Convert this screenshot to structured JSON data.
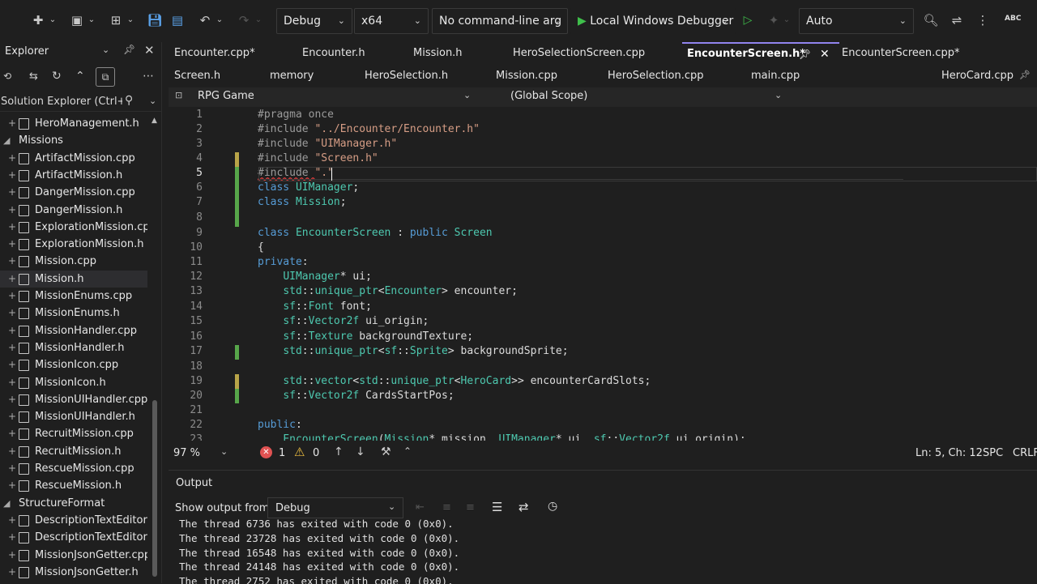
{
  "toolbar": {
    "config": "Debug",
    "platform": "x64",
    "args": "No command-line arg",
    "debugger": "Local Windows Debugger",
    "target": "Auto",
    "spell_label": "ABC"
  },
  "solution_explorer": {
    "title": "Explorer",
    "search_placeholder": "Solution Explorer (Ctrl+ş",
    "items": [
      {
        "label": "HeroManagement.h",
        "kind": "file"
      },
      {
        "label": "Missions",
        "kind": "folder"
      },
      {
        "label": "ArtifactMission.cpp",
        "kind": "file"
      },
      {
        "label": "ArtifactMission.h",
        "kind": "file"
      },
      {
        "label": "DangerMission.cpp",
        "kind": "file"
      },
      {
        "label": "DangerMission.h",
        "kind": "file"
      },
      {
        "label": "ExplorationMission.cpp",
        "kind": "file"
      },
      {
        "label": "ExplorationMission.h",
        "kind": "file"
      },
      {
        "label": "Mission.cpp",
        "kind": "file"
      },
      {
        "label": "Mission.h",
        "kind": "file",
        "selected": true
      },
      {
        "label": "MissionEnums.cpp",
        "kind": "file"
      },
      {
        "label": "MissionEnums.h",
        "kind": "file"
      },
      {
        "label": "MissionHandler.cpp",
        "kind": "file"
      },
      {
        "label": "MissionHandler.h",
        "kind": "file"
      },
      {
        "label": "MissionIcon.cpp",
        "kind": "file"
      },
      {
        "label": "MissionIcon.h",
        "kind": "file"
      },
      {
        "label": "MissionUIHandler.cpp",
        "kind": "file"
      },
      {
        "label": "MissionUIHandler.h",
        "kind": "file"
      },
      {
        "label": "RecruitMission.cpp",
        "kind": "file"
      },
      {
        "label": "RecruitMission.h",
        "kind": "file"
      },
      {
        "label": "RescueMission.cpp",
        "kind": "file"
      },
      {
        "label": "RescueMission.h",
        "kind": "file"
      },
      {
        "label": "StructureFormat",
        "kind": "folder"
      },
      {
        "label": "DescriptionTextEditor.c",
        "kind": "file"
      },
      {
        "label": "DescriptionTextEditor.h",
        "kind": "file"
      },
      {
        "label": "MissionJsonGetter.cpp",
        "kind": "file"
      },
      {
        "label": "MissionJsonGetter.h",
        "kind": "file"
      }
    ]
  },
  "tabs_row1": [
    "Encounter.cpp*",
    "Encounter.h",
    "Mission.h",
    "HeroSelectionScreen.cpp",
    "EncounterScreen.h*",
    "EncounterScreen.cpp*"
  ],
  "tabs_row2": [
    "Screen.h",
    "memory",
    "HeroSelection.h",
    "Mission.cpp",
    "HeroSelection.cpp",
    "main.cpp",
    "HeroCard.cpp"
  ],
  "nav": {
    "project": "RPG Game",
    "scope": "(Global Scope)"
  },
  "code_lines": [
    "1",
    "2",
    "3",
    "4",
    "5",
    "6",
    "7",
    "8",
    "9",
    "10",
    "11",
    "12",
    "13",
    "14",
    "15",
    "16",
    "17",
    "18",
    "19",
    "20",
    "21",
    "22",
    "23"
  ],
  "status": {
    "zoom": "97 %",
    "errors": "1",
    "warnings": "0",
    "position": "Ln: 5, Ch: 12",
    "whitespace": "SPC",
    "eol": "CRLF"
  },
  "output": {
    "title": "Output",
    "show_from_label": "Show output from:",
    "source": "Debug",
    "lines": [
      "The thread 6736 has exited with code 0 (0x0).",
      "The thread 23728 has exited with code 0 (0x0).",
      "The thread 16548 has exited with code 0 (0x0).",
      "The thread 24148 has exited with code 0 (0x0).",
      "The thread 2752 has exited with code 0 (0x0)."
    ]
  },
  "colors": {
    "accent": "#9184ee",
    "keyword": "#569cd6",
    "type": "#4ec9b0",
    "string": "#d69d85",
    "change_bar": "#57a64a"
  }
}
